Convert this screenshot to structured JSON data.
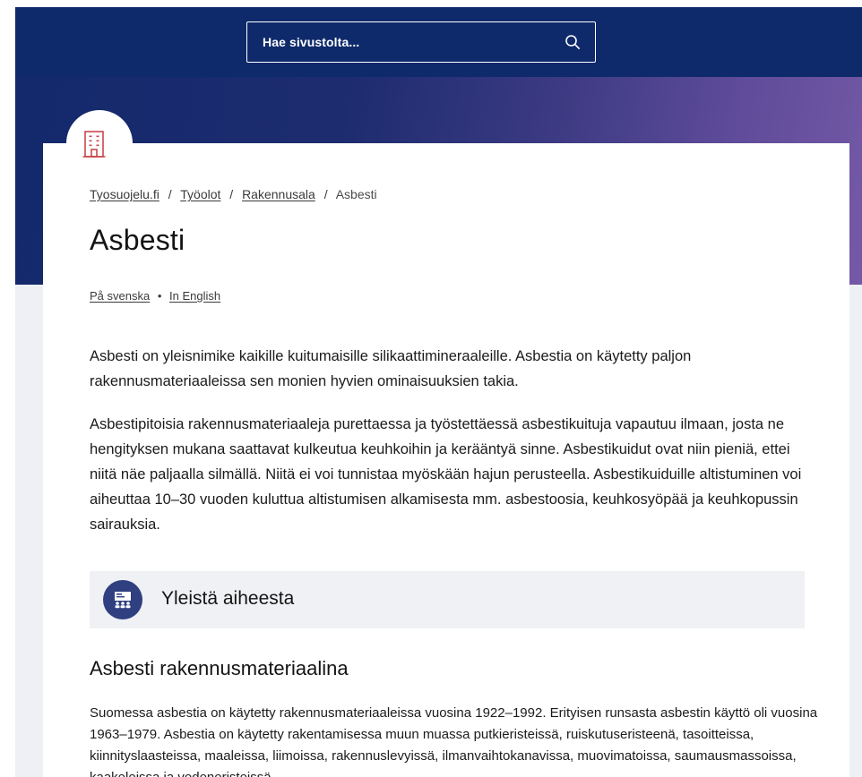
{
  "search": {
    "label": "Hae sivustolta...",
    "icon": "search-icon"
  },
  "page": {
    "icon": "building-icon",
    "title": "Asbesti"
  },
  "breadcrumb": {
    "items": [
      "Tyosuojelu.fi",
      "Työolot",
      "Rakennusala",
      "Asbesti"
    ],
    "separator": "/"
  },
  "languages": {
    "items": [
      "På svenska",
      "In English"
    ],
    "separator": "•"
  },
  "intro": {
    "paragraphs": [
      "Asbesti on yleisnimike kaikille kuitumaisille silikaattimineraaleille. Asbestia on käytetty paljon rakennusmateriaaleissa sen monien hyvien ominaisuuksien takia.",
      "Asbestipitoisia rakennusmateriaaleja purettaessa ja työstettäessä asbestikuituja vapautuu ilmaan, josta ne hengityksen mukana saattavat kulkeutua keuhkoihin ja kerääntyä sinne. Asbestikuidut ovat niin pieniä, ettei niitä näe paljaalla silmällä. Niitä ei voi tunnistaa myöskään hajun perusteella. Asbestikuiduille altistuminen voi aiheuttaa 10–30 vuoden kuluttua altistumisen alkamisesta mm. asbestoosia, keuhkosyöpää ja keuhkopussin sairauksia."
    ]
  },
  "topic_box": {
    "label": "Yleistä aiheesta",
    "icon": "presentation-icon"
  },
  "section": {
    "heading": "Asbesti rakennusmateriaalina",
    "text": "Suomessa asbestia on käytetty rakennusmateriaaleissa vuosina 1922–1992. Erityisen runsasta asbestin käyttö oli vuosina 1963–1979. Asbestia on käytetty rakentamisessa muun muassa putkieristeissä, ruiskutuseristeenä, tasoitteissa, kiinnityslaasteissa, maaleissa, liimoissa, rakennuslevyissä, ilmanvaihtokanavissa, muovimatoissa, saumausmassoissa, kaakeleissa ja vedeneristeissä."
  },
  "colors": {
    "header_navy": "#0f2a6b",
    "gradient_purple": "#7459a6",
    "page_background": "#eef0f6",
    "building_icon": "#c9474c",
    "topic_icon_bg": "#2f3f7f",
    "topic_box_bg": "#f0f1f5"
  }
}
